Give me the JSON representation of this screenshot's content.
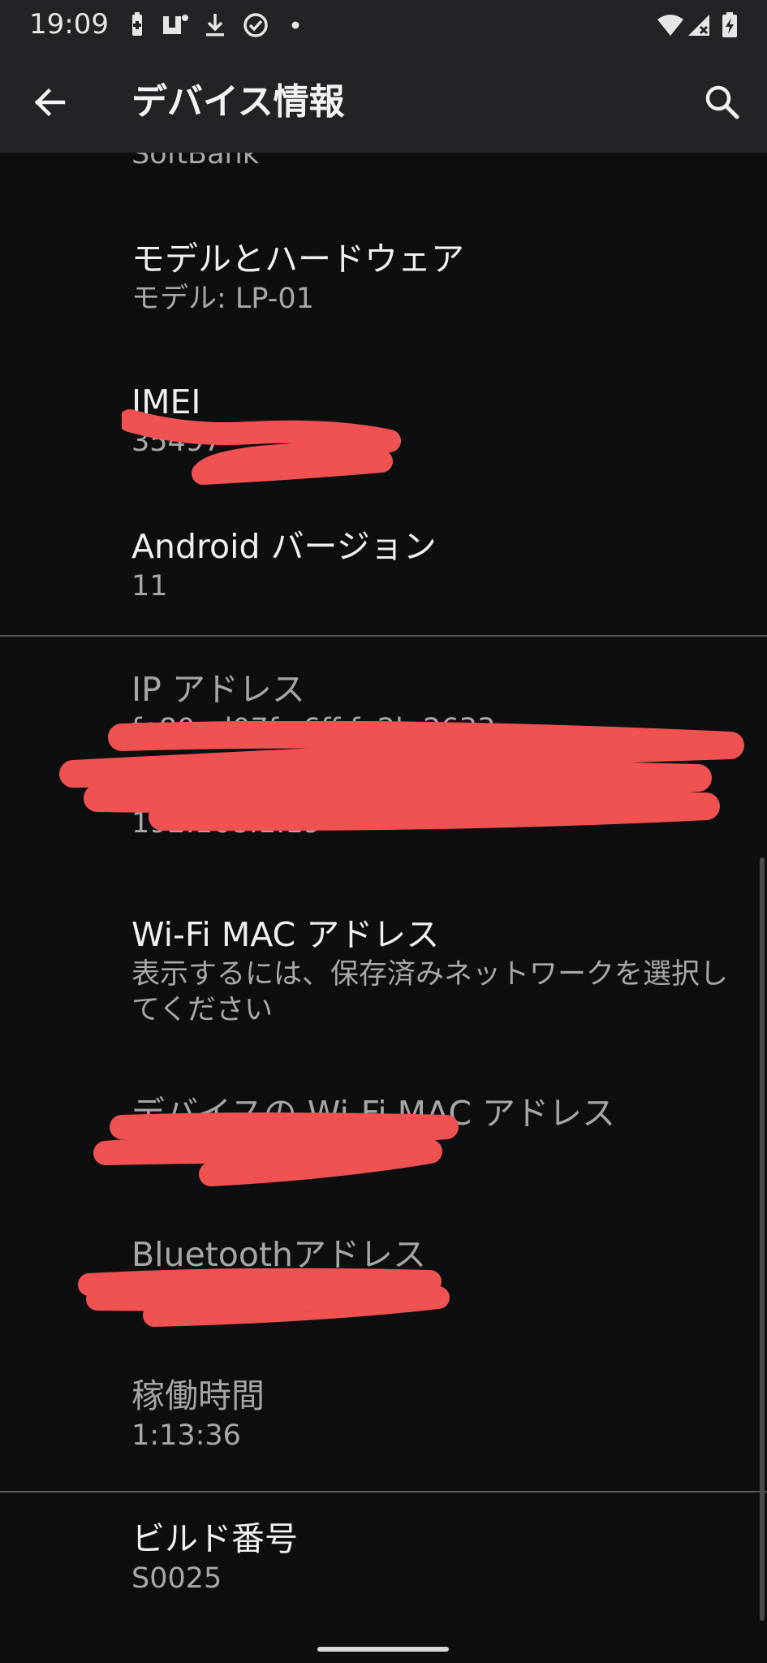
{
  "status_bar": {
    "time": "19:09"
  },
  "app_bar": {
    "title": "デバイス情報"
  },
  "items": {
    "carrier": {
      "value": "SoftBank"
    },
    "model": {
      "title": "モデルとハードウェア",
      "value": "モデル: LP-01"
    },
    "imei": {
      "title": "IMEI",
      "value": "35497"
    },
    "android": {
      "title": "Android バージョン",
      "value": "11"
    },
    "ip": {
      "title": "IP アドレス",
      "value": "fe80::d07f:c6ff:fe2b:2633",
      "value2": "192.168.1.19"
    },
    "wifi_mac": {
      "title": "Wi-Fi MAC アドレス",
      "value": "表示するには、保存済みネットワークを選択してください"
    },
    "device_mac": {
      "title": "デバイスの Wi-Fi MAC アドレス"
    },
    "bluetooth": {
      "title": "Bluetoothアドレス"
    },
    "uptime": {
      "title": "稼働時間",
      "value": "1:13:36"
    },
    "build": {
      "title": "ビルド番号",
      "value": "S0025"
    }
  },
  "colors": {
    "background": "#0d0e10",
    "app_bar": "#212327",
    "redaction": "#f05252"
  }
}
